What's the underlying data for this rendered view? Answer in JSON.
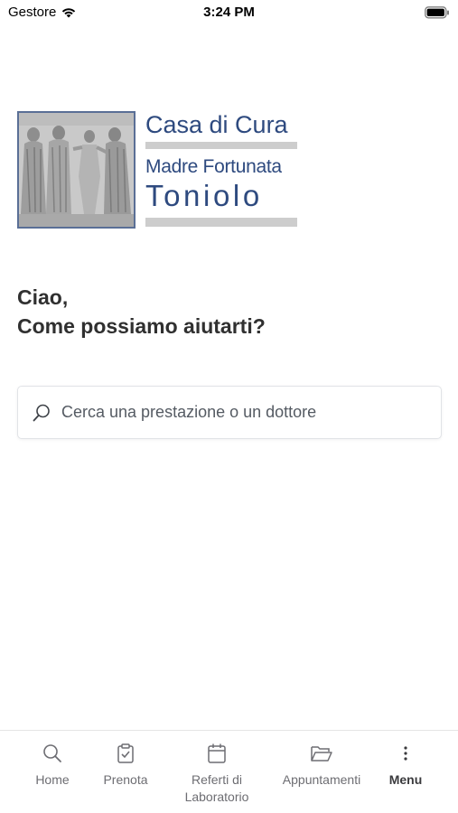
{
  "status_bar": {
    "carrier": "Gestore",
    "time": "3:24 PM"
  },
  "logo": {
    "line1": "Casa di Cura",
    "line2": "Madre Fortunata",
    "line3": "Toniolo"
  },
  "greeting": {
    "line1": "Ciao,",
    "line2": "Come possiamo aiutarti?"
  },
  "search": {
    "placeholder": "Cerca una prestazione o un dottore",
    "value": ""
  },
  "nav": {
    "items": [
      {
        "label": "Home",
        "icon": "search-icon"
      },
      {
        "label": "Prenota",
        "icon": "clipboard-check-icon"
      },
      {
        "label_line1": "Referti di",
        "label_line2": "Laboratorio",
        "icon": "calendar-icon"
      },
      {
        "label": "Appuntamenti",
        "icon": "folder-open-icon"
      },
      {
        "label": "Menu",
        "icon": "more-vertical-icon",
        "active": true
      }
    ]
  }
}
